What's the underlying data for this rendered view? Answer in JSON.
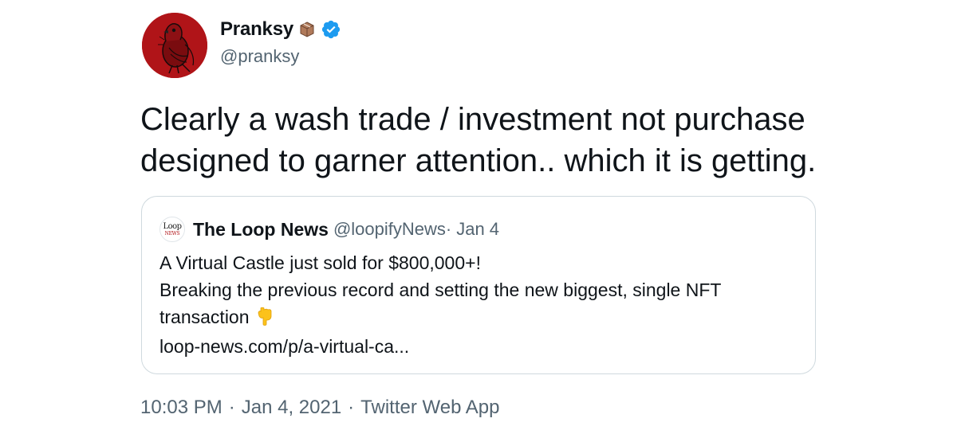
{
  "author": {
    "name": "Pranksy",
    "handle": "@pranksy",
    "icons": [
      "avatar-pigeon",
      "package-icon",
      "verified-badge-icon"
    ]
  },
  "tweet": {
    "text_lines": [
      "Clearly a wash trade / investment not purchase",
      "designed to garner attention.. which it is getting."
    ]
  },
  "quoted_tweet": {
    "avatar_text": {
      "line1": "Loop",
      "line2": "NEWS"
    },
    "name": "The Loop News",
    "handle": "@loopifyNews",
    "separator": "·",
    "date": "Jan 4",
    "lines": [
      "A Virtual Castle just sold for $800,000+!",
      "Breaking the previous record and setting the new biggest, single NFT",
      "transaction",
      "loop-news.com/p/a-virtual-ca..."
    ],
    "emoji_icon": "pointing-down-hand-icon"
  },
  "meta": {
    "time": "10:03 PM",
    "separator": "·",
    "date": "Jan 4, 2021",
    "source": "Twitter Web App"
  },
  "colors": {
    "text_primary": "#0f1419",
    "text_secondary": "#536471",
    "border": "#cfd9de",
    "verified": "#1d9bf0",
    "avatar_bg": "#b01418"
  }
}
